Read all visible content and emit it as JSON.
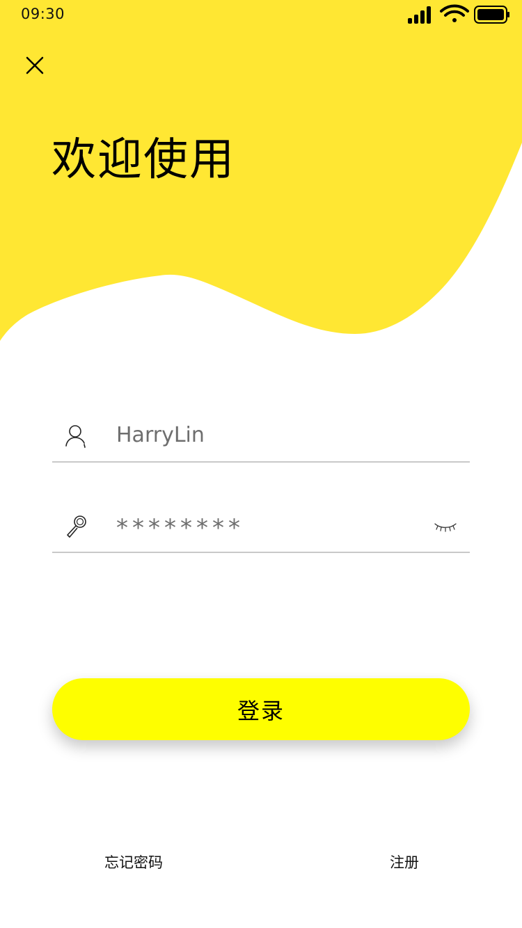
{
  "status_bar": {
    "time": "09:30",
    "icons": [
      "signal-icon",
      "wifi-icon",
      "battery-icon"
    ]
  },
  "header": {
    "close_icon": "close-icon",
    "title": "欢迎使用"
  },
  "form": {
    "username": {
      "icon": "user-icon",
      "value": "HarryLin"
    },
    "password": {
      "icon": "key-icon",
      "value": "********",
      "toggle_icon": "eye-closed-icon"
    },
    "login_label": "登录"
  },
  "footer": {
    "forgot_label": "忘记密码",
    "register_label": "注册"
  },
  "colors": {
    "header_yellow": "#ffe733",
    "button_yellow": "#fefe00",
    "divider": "#c9c9c9",
    "input_text": "#6e6e6e"
  }
}
